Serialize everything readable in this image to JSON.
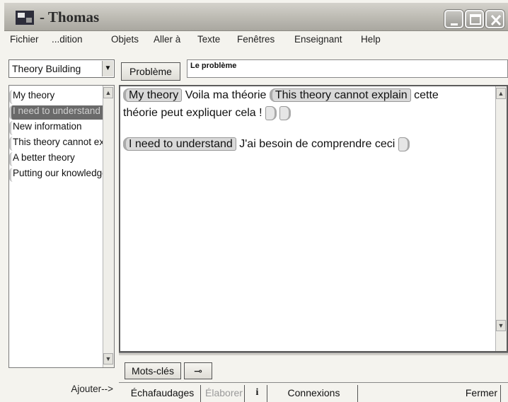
{
  "window": {
    "title": "- Thomas"
  },
  "menu": [
    "Fichier",
    "...dition",
    "Objets",
    "Aller à",
    "Texte",
    "Fenêtres",
    "Enseignant",
    "Help"
  ],
  "left": {
    "view_select": "Theory Building",
    "notes": [
      "My theory",
      "I need to understand",
      "New information",
      "This theory cannot explain",
      "A better theory",
      "Putting our knowledge together"
    ],
    "selected_index": 1,
    "add_button": "Ajouter-->"
  },
  "problem": {
    "button": "Problème",
    "value": "Le problème"
  },
  "editor": {
    "line1": {
      "scaffold1": "My theory",
      "text1": "Voila ma théorie",
      "scaffold2": "This theory cannot explain",
      "text2": "cette"
    },
    "line2": {
      "text": "théorie peut expliquer cela !"
    },
    "line3": {
      "scaffold": "I need to understand",
      "text": "J'ai besoin de comprendre ceci"
    }
  },
  "toolbar": {
    "keywords": "Mots-clés",
    "link_glyph": "⊸",
    "scaffolds": "Échafaudages",
    "elaborate": "Élaborer",
    "info": "i",
    "connections": "Connexions",
    "close": "Fermer"
  },
  "colors": {
    "selected_item": "#6a6a6a",
    "scaffold_tag": "#d9d9d9"
  }
}
